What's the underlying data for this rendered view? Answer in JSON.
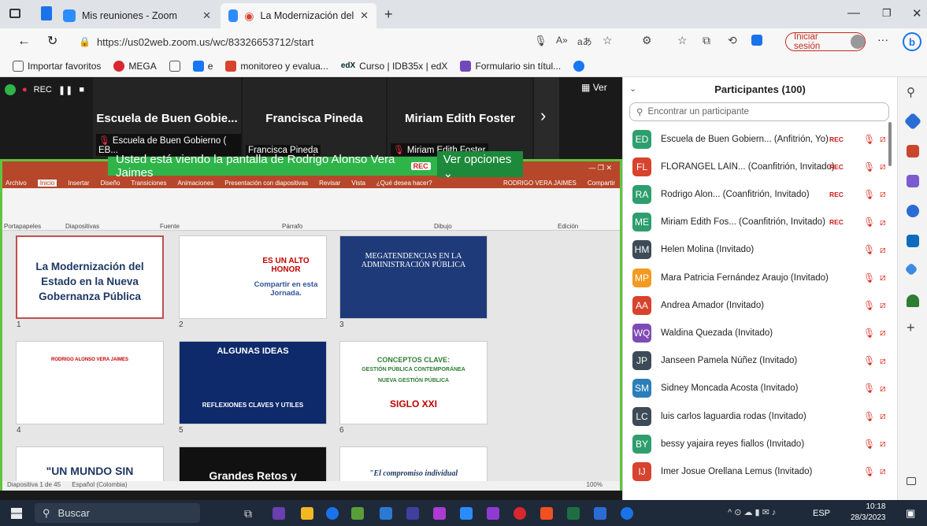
{
  "browser": {
    "tabs": [
      {
        "title": "Mis reuniones - Zoom"
      },
      {
        "title": "La Modernización del Estad"
      }
    ],
    "url": "https://us02web.zoom.us/wc/83326653712/start",
    "signin": "Iniciar sesión",
    "favorites": [
      "Importar favoritos",
      "MEGA",
      "e",
      "monitoreo y evalua...",
      "Curso | IDB35x | edX",
      "Formulario sin títul..."
    ]
  },
  "zoom": {
    "rec_label": "REC",
    "view_label": "Ver",
    "videos": [
      {
        "name": "Escuela de Buen Gobie...",
        "label": "Escuela de Buen Gobierno ( EB..."
      },
      {
        "name": "Francisca Pineda",
        "label": "Francisca Pineda"
      },
      {
        "name": "Miriam Edith Foster",
        "label": "Miriam Edith Foster"
      }
    ],
    "banner": "Usted está viendo la pantalla de Rodrigo Alonso Vera Jaimes",
    "banner_rec": "REC",
    "banner_options": "Ver opciones"
  },
  "ppt": {
    "menu": [
      "Archivo",
      "Inicio",
      "Insertar",
      "Diseño",
      "Transiciones",
      "Animaciones",
      "Presentación con diapositivas",
      "Revisar",
      "Vista",
      "¿Qué desea hacer?"
    ],
    "user": "RODRIGO VERA JAIMES",
    "share": "Compartir",
    "groups": [
      "Portapapeles",
      "Diapositivas",
      "Fuente",
      "Párrafo",
      "Dibujo",
      "Edición"
    ],
    "slides": [
      {
        "num": "1",
        "text": "La Modernización del Estado en la Nueva Gobernanza Pública"
      },
      {
        "num": "2",
        "text": "ES UN ALTO HONOR",
        "sub": "Compartir en esta Jornada."
      },
      {
        "num": "3",
        "text": "MEGATENDENCIAS EN LA ADMINISTRACIÓN PÚBLICA"
      },
      {
        "num": "4",
        "text": "RODRIGO ALONSO VERA JAIMES"
      },
      {
        "num": "5",
        "text": "ALGUNAS IDEAS",
        "sub": "REFLEXIONES CLAVES Y UTILES"
      },
      {
        "num": "6",
        "text": "CONCEPTOS CLAVE:",
        "sub": "GESTIÓN PÚBLICA CONTEMPORÁNEA",
        "sub2": "NUEVA GESTIÓN PÚBLICA",
        "sub3": "SIGLO XXI"
      },
      {
        "num": "",
        "text": "\"UN MUNDO SIN"
      },
      {
        "num": "",
        "text": "Grandes Retos y"
      },
      {
        "num": "",
        "text": "\"El compromiso individual"
      }
    ],
    "status": "Diapositiva 1 de 45",
    "lang": "Español (Colombia)",
    "zoom": "100%"
  },
  "participants": {
    "title": "Participantes (100)",
    "search_placeholder": "Encontrar un participante",
    "list": [
      {
        "initials": "ED",
        "color": "#2e9e6e",
        "name": "Escuela de Buen Gobiern... (Anfitrión, Yo)",
        "rec": "REC"
      },
      {
        "initials": "FL",
        "color": "#d7432d",
        "name": "FLORANGEL LAIN... (Coanfitrión, Invitado)",
        "rec": "REC"
      },
      {
        "initials": "RA",
        "color": "#2e9e6e",
        "name": "Rodrigo Alon... (Coanfitrión, Invitado)",
        "rec": "REC"
      },
      {
        "initials": "ME",
        "color": "#2e9e6e",
        "name": "Miriam Edith Fos... (Coanfitrión, Invitado)",
        "rec": "REC"
      },
      {
        "initials": "HM",
        "color": "#3c4b57",
        "name": "Helen Molina (Invitado)",
        "rec": ""
      },
      {
        "initials": "MP",
        "color": "#f39a21",
        "name": "Mara Patricia Fernández Araujo (Invitado)",
        "rec": ""
      },
      {
        "initials": "AA",
        "color": "#d7432d",
        "name": "Andrea Amador (Invitado)",
        "rec": ""
      },
      {
        "initials": "WQ",
        "color": "#7e4bb3",
        "name": "Waldina Quezada (Invitado)",
        "rec": ""
      },
      {
        "initials": "JP",
        "color": "#3c4b57",
        "name": "Janseen Pamela Núñez (Invitado)",
        "rec": ""
      },
      {
        "initials": "SM",
        "color": "#2b7fb8",
        "name": "Sidney Moncada Acosta (Invitado)",
        "rec": ""
      },
      {
        "initials": "LC",
        "color": "#3c4b57",
        "name": "luis carlos laguardia rodas (Invitado)",
        "rec": ""
      },
      {
        "initials": "BY",
        "color": "#2e9e6e",
        "name": "bessy yajaira reyes fiallos (Invitado)",
        "rec": ""
      },
      {
        "initials": "IJ",
        "color": "#d7432d",
        "name": "Imer Josue Orellana Lemus (Invitado)",
        "rec": ""
      }
    ]
  },
  "taskbar": {
    "search": "Buscar",
    "lang": "ESP",
    "time": "10:18",
    "date": "28/3/2023"
  }
}
